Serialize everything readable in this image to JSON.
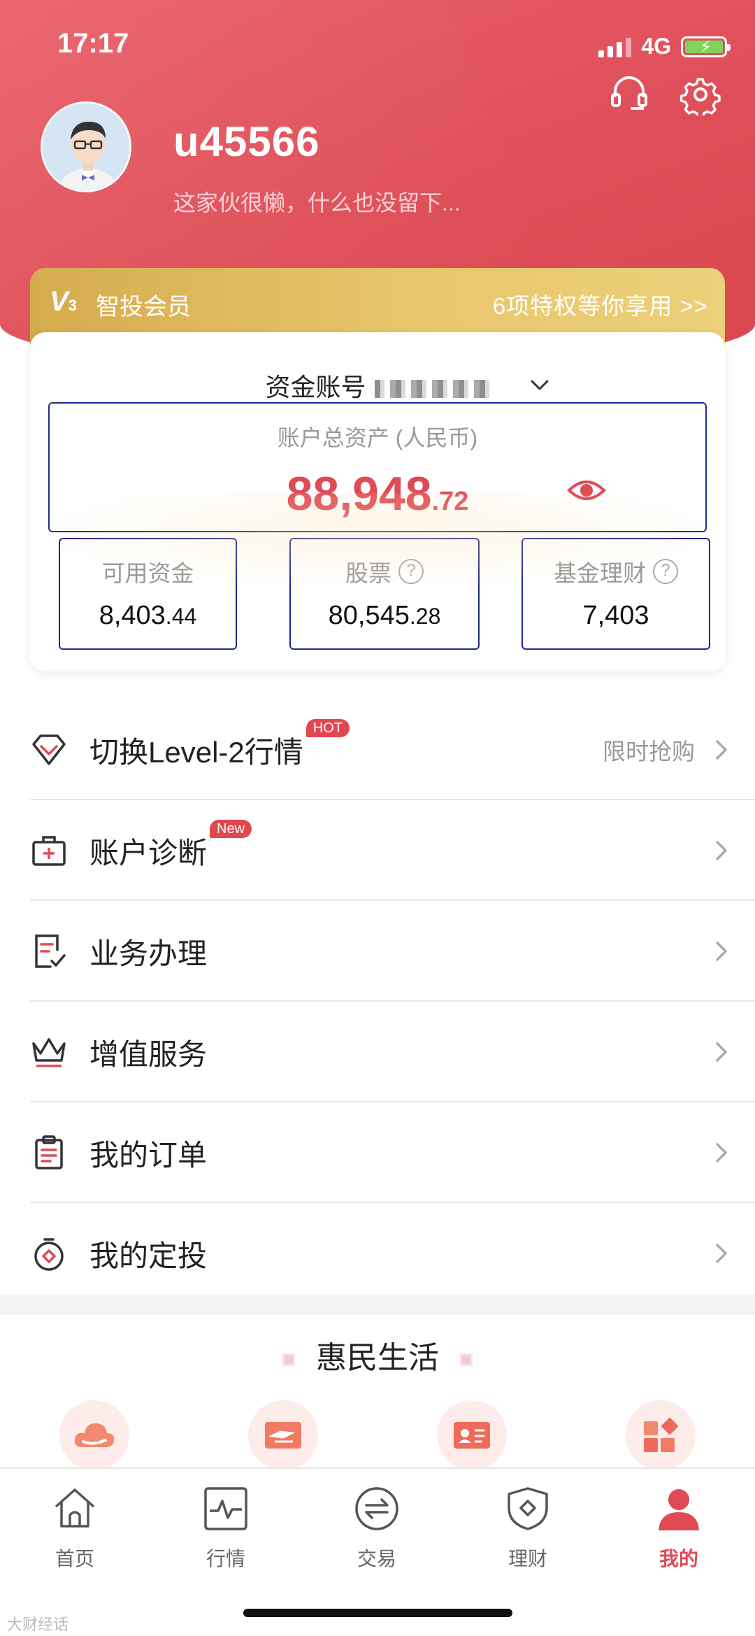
{
  "status_bar": {
    "time": "17:17",
    "network": "4G"
  },
  "profile": {
    "username": "u45566",
    "signature": "这家伙很懒，什么也没留下..."
  },
  "member": {
    "logo": "V",
    "logo_sub": "3",
    "title": "智投会员",
    "link": "6项特权等你享用 >>"
  },
  "account": {
    "label": "资金账号",
    "total_label": "账户总资产 (人民币)",
    "total_int": "88,948",
    "total_dec": ".72",
    "available": {
      "label": "可用资金",
      "int": "8,403",
      "dec": ".44"
    },
    "stocks": {
      "label": "股票",
      "int": "80,545",
      "dec": ".28"
    },
    "funds": {
      "label": "基金理财",
      "int": "7,403",
      "dec": ""
    },
    "help_mark": "?"
  },
  "menu": [
    {
      "label": "切换Level-2行情",
      "badge": "HOT",
      "right": "限时抢购"
    },
    {
      "label": "账户诊断",
      "badge": "New",
      "right": ""
    },
    {
      "label": "业务办理",
      "badge": "",
      "right": ""
    },
    {
      "label": "增值服务",
      "badge": "",
      "right": ""
    },
    {
      "label": "我的订单",
      "badge": "",
      "right": ""
    },
    {
      "label": "我的定投",
      "badge": "",
      "right": ""
    }
  ],
  "benefits": {
    "title": "惠民生活"
  },
  "tabs": [
    {
      "label": "首页",
      "icon": "home-icon"
    },
    {
      "label": "行情",
      "icon": "chart-icon"
    },
    {
      "label": "交易",
      "icon": "exchange-icon"
    },
    {
      "label": "理财",
      "icon": "shield-icon"
    },
    {
      "label": "我的",
      "icon": "person-icon",
      "active": true
    }
  ],
  "watermark": "大财经话",
  "colors": {
    "brand": "#e04a55",
    "gold": "#e3bf62",
    "frame": "#1f2a8c"
  }
}
